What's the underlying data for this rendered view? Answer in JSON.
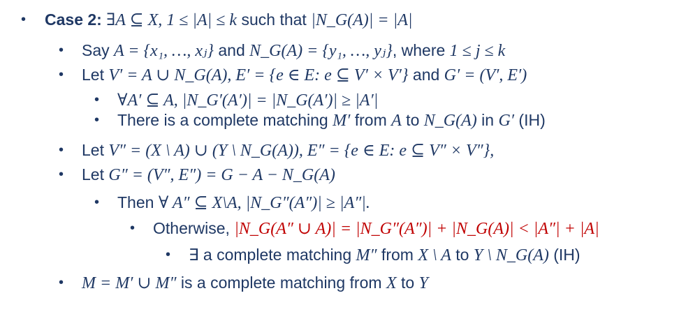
{
  "lines": [
    {
      "bullet": "•",
      "parts": [
        {
          "t": "Case 2: ",
          "k": "bold"
        },
        {
          "t": "∃A ⊆ X, 1 ≤ |A| ≤ k",
          "k": "m"
        },
        {
          "t": " such that ",
          "k": "txt"
        },
        {
          "t": "|N_G(A)| = |A|",
          "k": "m"
        }
      ]
    },
    {
      "bullet": "•",
      "parts": [
        {
          "t": "Say ",
          "k": "txt"
        },
        {
          "t": "A = {x₁, …, xⱼ}",
          "k": "m"
        },
        {
          "t": " and ",
          "k": "txt"
        },
        {
          "t": "N_G(A) = {y₁, …, yⱼ}",
          "k": "m"
        },
        {
          "t": ", where ",
          "k": "txt"
        },
        {
          "t": "1 ≤ j ≤ k",
          "k": "m"
        }
      ]
    },
    {
      "bullet": "•",
      "parts": [
        {
          "t": "Let ",
          "k": "txt"
        },
        {
          "t": "V′ = A ∪ N_G(A), E′ = {e ∈ E: e ⊆ V′ × V′}",
          "k": "m"
        },
        {
          "t": " and ",
          "k": "txt"
        },
        {
          "t": "G′ = (V′, E′)",
          "k": "m"
        }
      ]
    },
    {
      "bullet": "•",
      "parts": [
        {
          "t": "∀A′ ⊆ A,  |N_G′(A′)| = |N_G(A′)| ≥ |A′|",
          "k": "m"
        }
      ]
    },
    {
      "bullet": "•",
      "parts": [
        {
          "t": "There is a complete matching ",
          "k": "txt"
        },
        {
          "t": "M′",
          "k": "m"
        },
        {
          "t": " from ",
          "k": "txt"
        },
        {
          "t": "A",
          "k": "m"
        },
        {
          "t": " to ",
          "k": "txt"
        },
        {
          "t": "N_G(A)",
          "k": "m"
        },
        {
          "t": " in ",
          "k": "txt"
        },
        {
          "t": "G′",
          "k": "m"
        },
        {
          "t": " (IH)",
          "k": "txt"
        }
      ]
    },
    {
      "bullet": "•",
      "parts": [
        {
          "t": "Let ",
          "k": "txt"
        },
        {
          "t": "V″ = (X \\ A) ∪ (Y \\ N_G(A)), E″ = {e ∈ E: e ⊆ V″ × V″},",
          "k": "m"
        }
      ]
    },
    {
      "bullet": "•",
      "parts": [
        {
          "t": "Let ",
          "k": "txt"
        },
        {
          "t": "G″ = (V″, E″) = G − A − N_G(A)",
          "k": "m"
        }
      ]
    },
    {
      "bullet": "•",
      "parts": [
        {
          "t": "Then ",
          "k": "txt"
        },
        {
          "t": "∀ A″ ⊆ X\\A, |N_G″(A″)| ≥ |A″|.",
          "k": "m"
        }
      ]
    },
    {
      "bullet": "•",
      "parts": [
        {
          "t": "Otherwise, ",
          "k": "txt"
        },
        {
          "t": "|N_G(A″ ∪ A)| = |N_G″(A″)| + |N_G(A)| < |A″| + |A|",
          "k": "m red"
        }
      ]
    },
    {
      "bullet": "•",
      "parts": [
        {
          "t": "∃ a complete matching ",
          "k": "txt"
        },
        {
          "t": "M″",
          "k": "m"
        },
        {
          "t": " from ",
          "k": "txt"
        },
        {
          "t": "X \\ A",
          "k": "m"
        },
        {
          "t": " to ",
          "k": "txt"
        },
        {
          "t": "Y \\ N_G(A)",
          "k": "m"
        },
        {
          "t": "  (IH)",
          "k": "txt"
        }
      ]
    },
    {
      "bullet": "•",
      "parts": [
        {
          "t": "M = M′ ∪ M″",
          "k": "m"
        },
        {
          "t": " is a complete matching from ",
          "k": "txt"
        },
        {
          "t": "X",
          "k": "m"
        },
        {
          "t": " to ",
          "k": "txt"
        },
        {
          "t": "Y",
          "k": "m"
        }
      ]
    }
  ]
}
